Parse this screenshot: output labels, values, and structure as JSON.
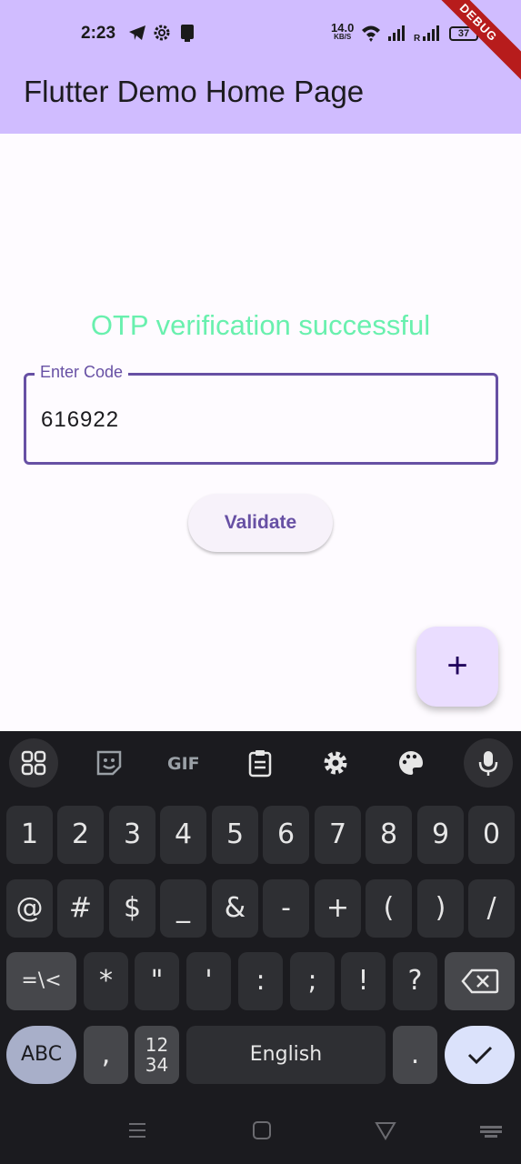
{
  "status_bar": {
    "time": "2:23",
    "net_speed_value": "14.0",
    "net_speed_unit": "KB/S",
    "battery": "37",
    "icons": [
      "telegram-icon",
      "settings-icon",
      "app-icon",
      "wifi-icon",
      "signal-icon",
      "roaming-signal-icon",
      "battery-icon"
    ]
  },
  "app_bar": {
    "title": "Flutter Demo Home Page",
    "debug_banner": "DEBUG"
  },
  "main": {
    "status_message": "OTP verification successful",
    "code_field": {
      "label": "Enter Code",
      "value": "616922"
    },
    "validate_label": "Validate",
    "fab_label": "+"
  },
  "keyboard": {
    "toolbar": [
      "apps-icon",
      "sticker-icon",
      "gif-icon",
      "clipboard-icon",
      "settings-icon",
      "palette-icon",
      "mic-icon"
    ],
    "row1": [
      "1",
      "2",
      "3",
      "4",
      "5",
      "6",
      "7",
      "8",
      "9",
      "0"
    ],
    "row2": [
      "@",
      "#",
      "$",
      "_",
      "&",
      "-",
      "+",
      "(",
      ")",
      "/"
    ],
    "row3": [
      "=\\<",
      "*",
      "\"",
      "'",
      ":",
      ";",
      "!",
      "?"
    ],
    "abc_label": "ABC",
    "comma_label": ",",
    "numpad_label_top": "12",
    "numpad_label_bottom": "34",
    "space_label": "English",
    "period_label": ".",
    "colors": {
      "background": "#1b1b1f",
      "key": "#2e2f33",
      "key_dark": "#46474b",
      "abc_key": "#a8afc9",
      "enter_key": "#dbe2fb"
    }
  },
  "colors": {
    "app_bar": "#d0bcff",
    "success_text": "#69f0ae",
    "primary": "#6750a4",
    "fab": "#eaddff"
  }
}
